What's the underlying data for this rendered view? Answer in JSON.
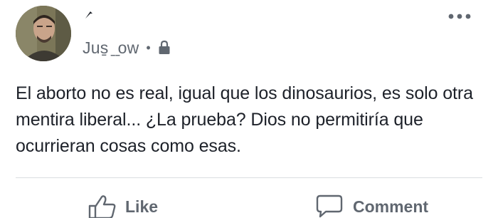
{
  "post": {
    "timestamp": "Jus̱ ̱ ̱ow",
    "text": "El aborto no es real, igual que los dinosaurios, es solo otra mentira liberal... ¿La prueba? Dios no permitiría que ocurrieran cosas como esas."
  },
  "actions": {
    "like_label": "Like",
    "comment_label": "Comment"
  },
  "icons": {
    "more": "more-horizontal-icon",
    "privacy": "privacy-lock-icon",
    "like": "thumbs-up-icon",
    "comment": "comment-bubble-icon"
  },
  "colors": {
    "text": "#1d2129",
    "secondary": "#606770",
    "divider": "#dadde1"
  }
}
